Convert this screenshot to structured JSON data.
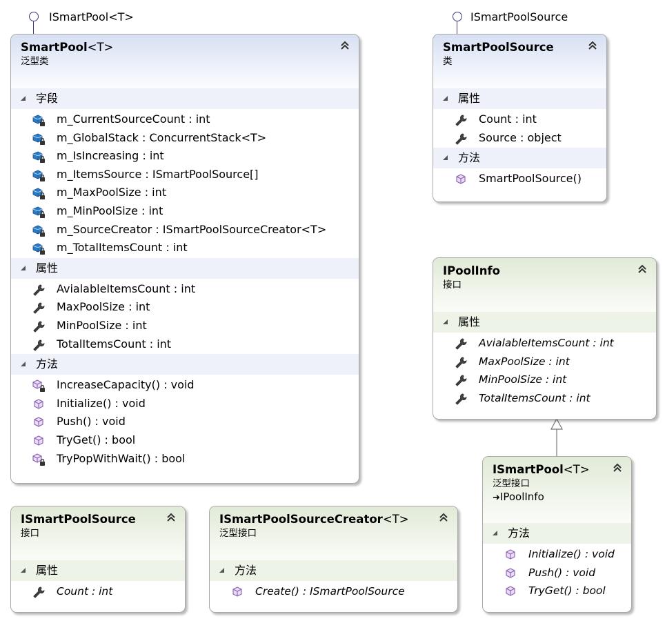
{
  "interfaces_lollipop": {
    "smartpool": "ISmartPool<T>",
    "smartpoolsource": "ISmartPoolSource"
  },
  "smartpool": {
    "name": "SmartPool",
    "generic": "<T>",
    "kind": "泛型类",
    "fields_label": "字段",
    "fields": [
      "m_CurrentSourceCount : int",
      "m_GlobalStack : ConcurrentStack<T>",
      "m_IsIncreasing : int",
      "m_ItemsSource : ISmartPoolSource[]",
      "m_MaxPoolSize : int",
      "m_MinPoolSize : int",
      "m_SourceCreator : ISmartPoolSourceCreator<T>",
      "m_TotalItemsCount : int"
    ],
    "props_label": "属性",
    "props": [
      "AvialableItemsCount : int",
      "MaxPoolSize : int",
      "MinPoolSize : int",
      "TotalItemsCount : int"
    ],
    "methods_label": "方法",
    "methods": [
      "IncreaseCapacity() : void",
      "Initialize() : void",
      "Push() : void",
      "TryGet() : bool",
      "TryPopWithWait() : bool"
    ]
  },
  "smartpoolsource": {
    "name": "SmartPoolSource",
    "kind": "类",
    "props_label": "属性",
    "props": [
      "Count : int",
      "Source : object"
    ],
    "methods_label": "方法",
    "methods": [
      "SmartPoolSource()"
    ]
  },
  "ipoolinfo": {
    "name": "IPoolInfo",
    "kind": "接口",
    "props_label": "属性",
    "props": [
      "AvialableItemsCount : int",
      "MaxPoolSize : int",
      "MinPoolSize : int",
      "TotalItemsCount : int"
    ]
  },
  "ismartpool": {
    "name": "ISmartPool",
    "generic": "<T>",
    "kind": "泛型接口",
    "base": "IPoolInfo",
    "methods_label": "方法",
    "methods": [
      "Initialize() : void",
      "Push() : void",
      "TryGet() : bool"
    ]
  },
  "ismartpoolsource": {
    "name": "ISmartPoolSource",
    "kind": "接口",
    "props_label": "属性",
    "props": [
      "Count : int"
    ]
  },
  "ismartpoolsourcecreator": {
    "name": "ISmartPoolSourceCreator",
    "generic": "<T>",
    "kind": "泛型接口",
    "methods_label": "方法",
    "methods": [
      "Create() : ISmartPoolSource"
    ]
  },
  "icons": {
    "field": "private-field-icon",
    "property": "wrench-property-icon",
    "method": "method-cube-icon",
    "private_method": "private-method-cube-icon",
    "collapse": "double-chevron-up-icon",
    "inherit": "inheritance-arrow-icon"
  },
  "colors": {
    "class_header": "#d7e0f3",
    "interface_header": "#e1ead7",
    "field_icon": "#1c6fb8",
    "method_icon": "#8a5fb0"
  }
}
